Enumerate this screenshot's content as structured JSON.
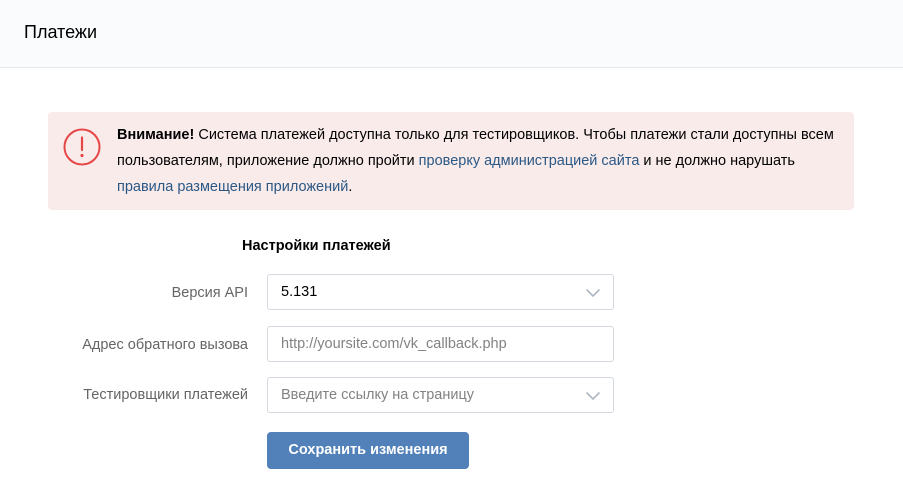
{
  "header": {
    "title": "Платежи"
  },
  "warning": {
    "bold": "Внимание!",
    "text_1": " Система платежей доступна только для тестировщиков. Чтобы платежи стали доступны всем пользователям, приложение должно пройти ",
    "link_1": "проверку администрацией сайта",
    "text_2": " и не должно нарушать ",
    "link_2": "правила размещения приложений",
    "text_3": ".",
    "icon": "exclamation-circle-icon",
    "color": "#faebeb",
    "link_color": "#2a5885"
  },
  "settings": {
    "title": "Настройки платежей",
    "api_version": {
      "label": "Версия API",
      "value": "5.131"
    },
    "callback_url": {
      "label": "Адрес обратного вызова",
      "value": "",
      "placeholder": "http://yoursite.com/vk_callback.php"
    },
    "testers": {
      "label": "Тестировщики платежей",
      "value": "",
      "placeholder": "Введите ссылку на страницу"
    },
    "save_label": "Сохранить изменения",
    "button_color": "#5181b8"
  }
}
